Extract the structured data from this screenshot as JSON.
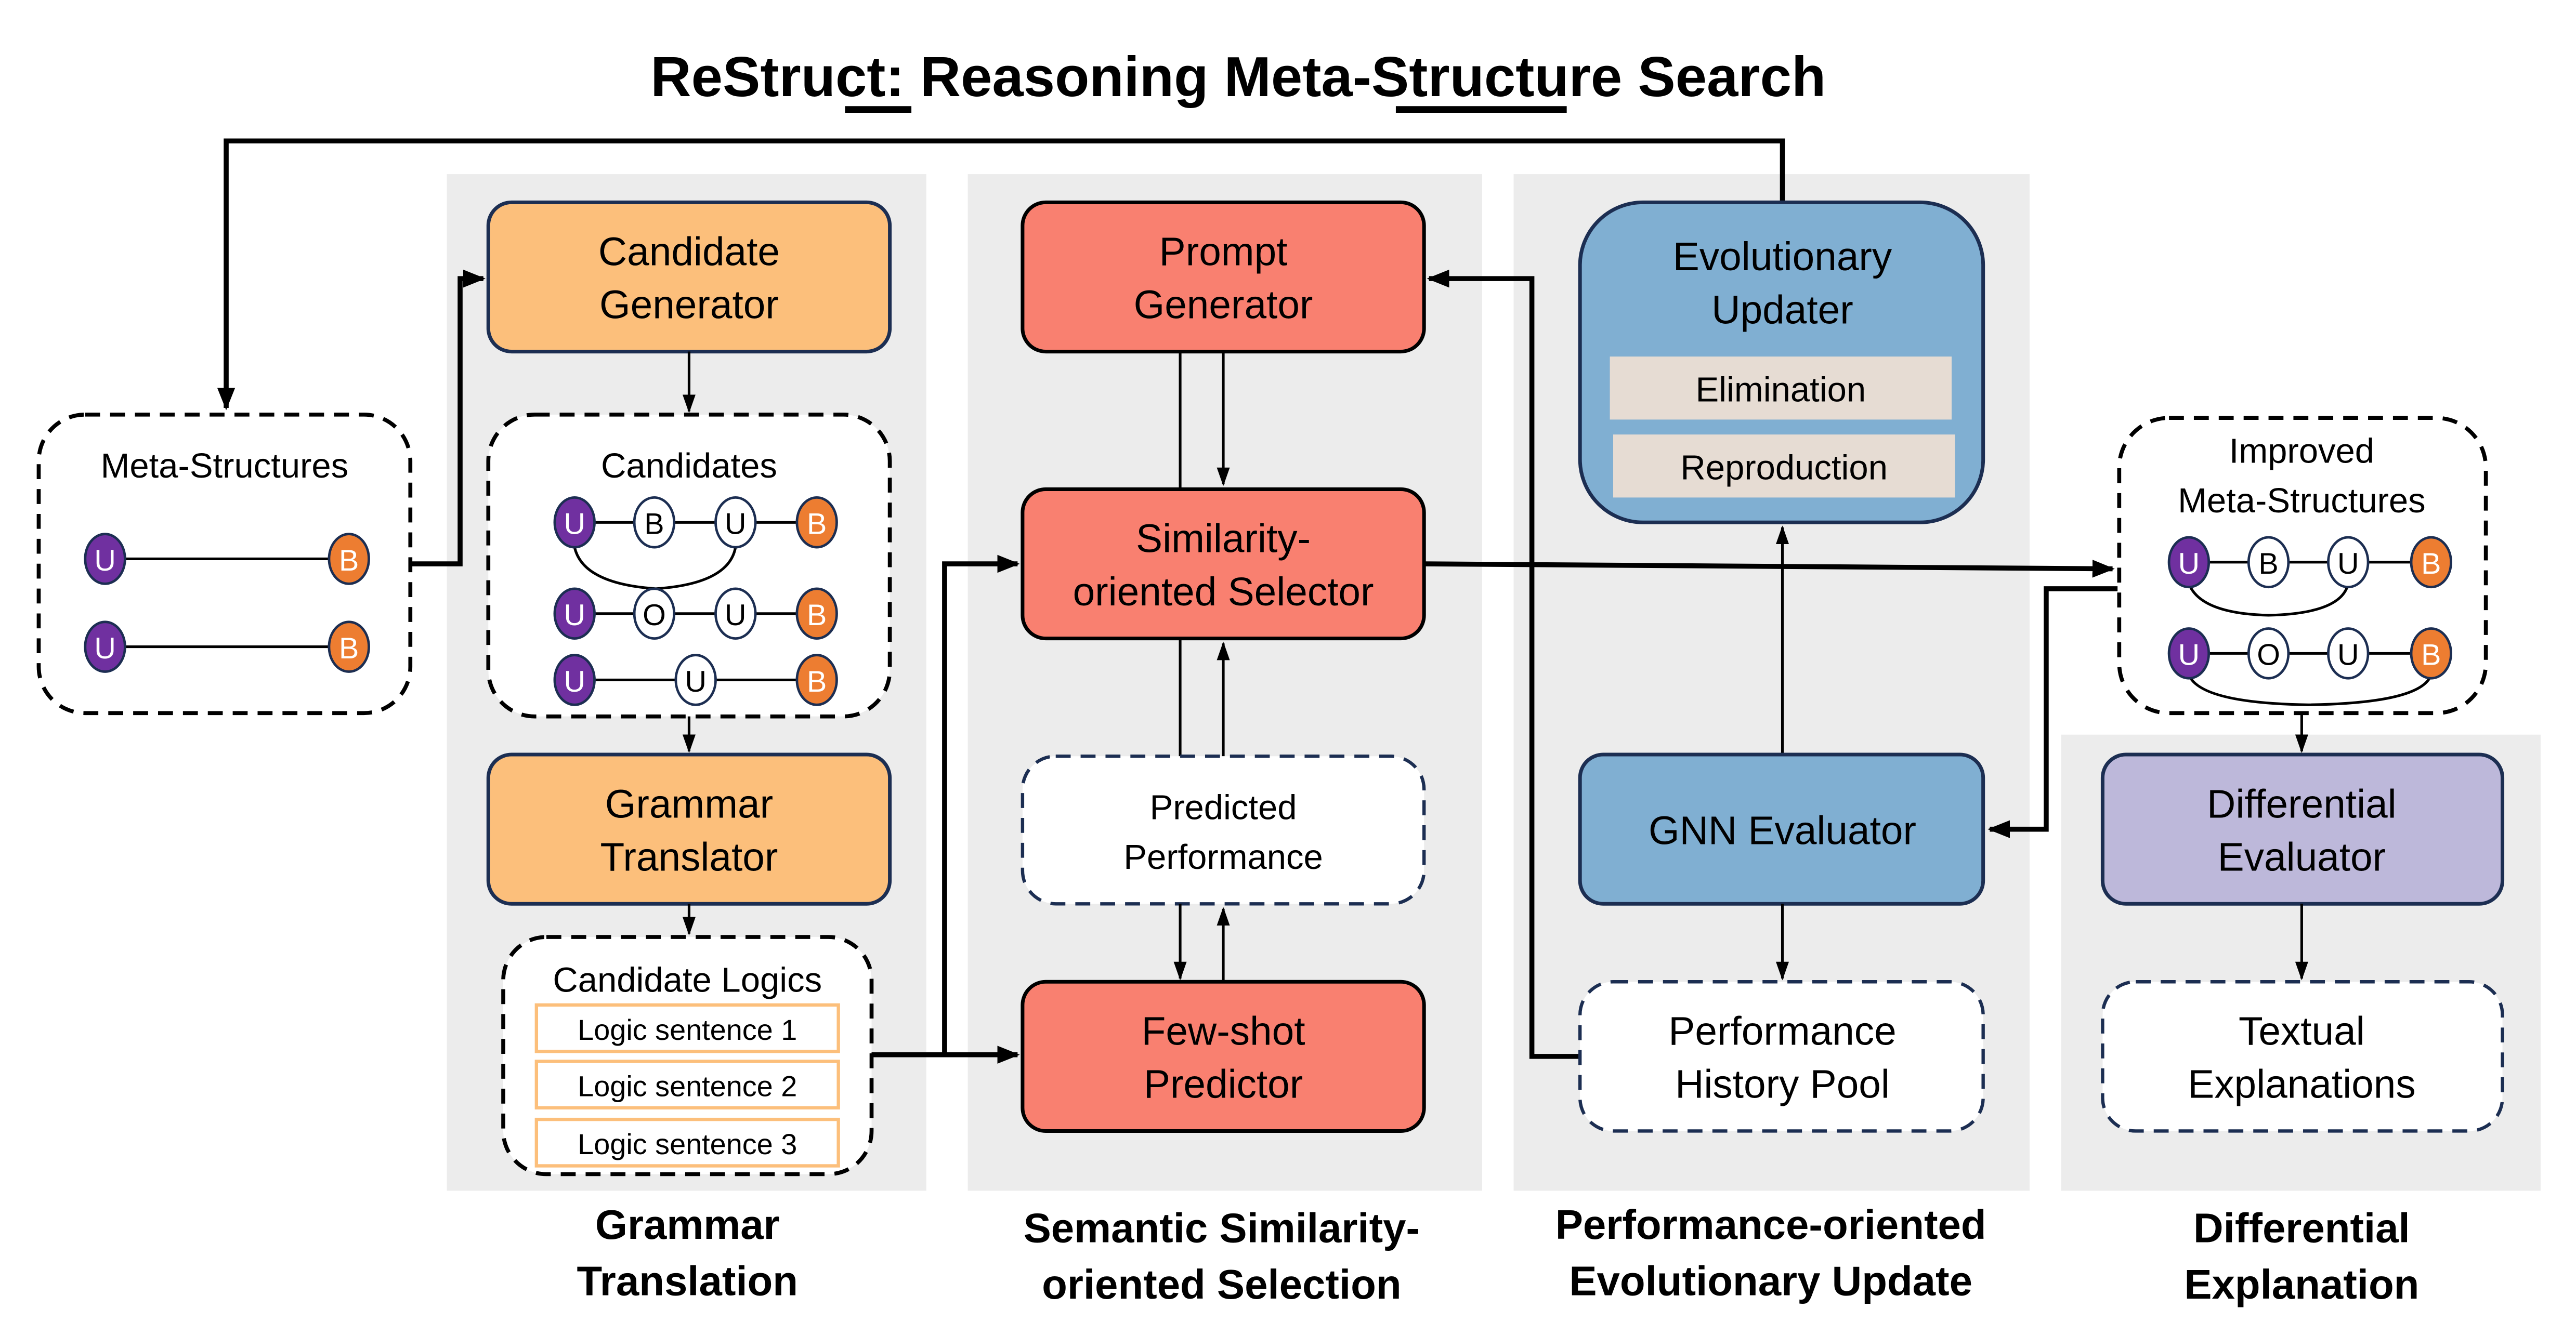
{
  "title": {
    "prefix": "ReStruct: ",
    "re": "Re",
    "middle": "asoning Meta-",
    "structure": "Structure",
    "suffix": " Search"
  },
  "colors": {
    "orange_box": "#fcbf7b",
    "red_box": "#f98070",
    "blue_box": "#80afd2",
    "purple_box": "#bdb8da",
    "sub_box": "#e6dcd3",
    "node_u": "#7030a0",
    "node_b": "#ed7d31",
    "panel_bg": "#ececec",
    "logic_border": "#fcbf7b"
  },
  "meta_structures": {
    "label": "Meta-Structures",
    "paths": [
      [
        "U",
        "B"
      ],
      [
        "U",
        "B"
      ]
    ]
  },
  "grammar": {
    "candidate_generator": [
      "Candidate",
      "Generator"
    ],
    "candidates": {
      "label": "Candidates",
      "paths": [
        [
          "U",
          "B",
          "U",
          "B"
        ],
        [
          "U",
          "O",
          "U",
          "B"
        ],
        [
          "U",
          "U",
          "B"
        ]
      ]
    },
    "grammar_translator": [
      "Grammar",
      "Translator"
    ],
    "candidate_logics": {
      "label": "Candidate Logics",
      "sentences": [
        "Logic sentence 1",
        "Logic sentence 2",
        "Logic sentence 3"
      ]
    },
    "caption": [
      "Grammar",
      "Translation"
    ]
  },
  "semantic": {
    "prompt_generator": [
      "Prompt",
      "Generator"
    ],
    "selector": [
      "Similarity-",
      "oriented Selector"
    ],
    "predicted_performance": [
      "Predicted",
      "Performance"
    ],
    "few_shot": [
      "Few-shot",
      "Predictor"
    ],
    "caption": [
      "Semantic Similarity-",
      "oriented Selection"
    ]
  },
  "performance": {
    "evolutionary_updater": [
      "Evolutionary",
      "Updater"
    ],
    "elimination": "Elimination",
    "reproduction": "Reproduction",
    "gnn_evaluator": "GNN Evaluator",
    "history_pool": [
      "Performance",
      "History Pool"
    ],
    "caption": [
      "Performance-oriented",
      "Evolutionary Update"
    ]
  },
  "improved": {
    "label": [
      "Improved",
      "Meta-Structures"
    ],
    "paths": [
      [
        "U",
        "B",
        "U",
        "B"
      ],
      [
        "U",
        "O",
        "U",
        "B"
      ]
    ]
  },
  "differential": {
    "evaluator": [
      "Differential",
      "Evaluator"
    ],
    "textual": [
      "Textual",
      "Explanations"
    ],
    "caption": [
      "Differential",
      "Explanation"
    ]
  }
}
